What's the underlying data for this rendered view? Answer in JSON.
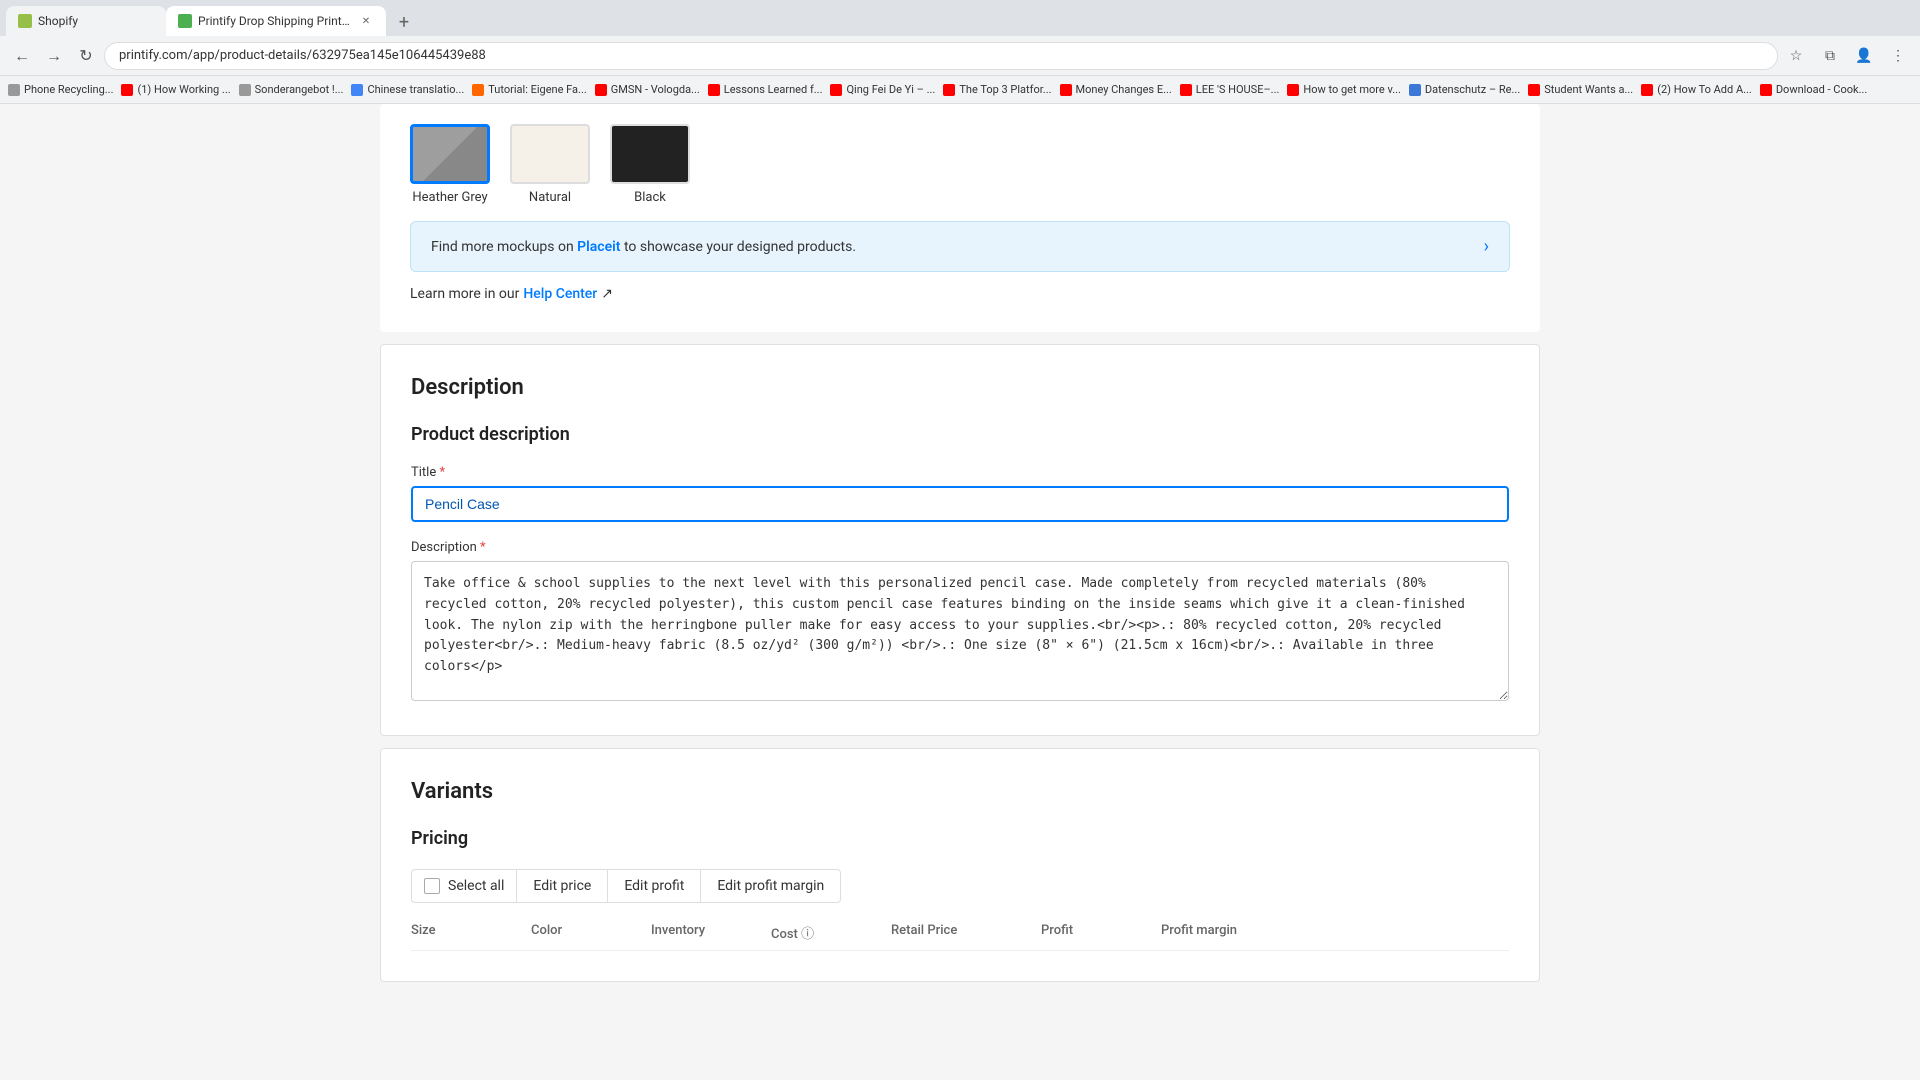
{
  "browser": {
    "tabs": [
      {
        "id": "shopify",
        "label": "Shopify",
        "favicon_color": "#96bf48",
        "active": false
      },
      {
        "id": "printify",
        "label": "Printify Drop Shipping Print o...",
        "favicon_color": "#4CAF50",
        "active": true
      }
    ],
    "new_tab_label": "+",
    "address": "printify.com/app/product-details/632975ea145e106445439e88",
    "bookmarks": [
      "Phone Recycling...",
      "(1) How Working ...",
      "Sonderangebot !...",
      "Chinese translatio...",
      "Tutorial: Eigene Fa...",
      "GMSN - Vologda...",
      "Lessons Learned f...",
      "Qing Fei De Yi – ...",
      "The Top 3 Platfor...",
      "Money Changes E...",
      "LEE 'S HOUSE–...",
      "How to get more v...",
      "Datenschutz – Re...",
      "Student Wants a...",
      "(2) How To Add A...",
      "Download - Cook..."
    ]
  },
  "swatches": {
    "items": [
      {
        "id": "heather-grey",
        "label": "Heather Grey",
        "active": true
      },
      {
        "id": "natural",
        "label": "Natural",
        "active": false
      },
      {
        "id": "black",
        "label": "Black",
        "active": false
      }
    ]
  },
  "placeit_banner": {
    "text_prefix": "Find more mockups on ",
    "link_text": "Placeit",
    "text_suffix": " to showcase your designed products.",
    "arrow": "›"
  },
  "help_center": {
    "prefix": "Learn more in our ",
    "link_text": "Help Center",
    "icon": "↗"
  },
  "description_section": {
    "title": "Description",
    "subsection_title": "Product description",
    "title_field": {
      "label": "Title",
      "required": true,
      "value": "Pencil Case"
    },
    "description_field": {
      "label": "Description",
      "required": true,
      "value": "Take office & school supplies to the next level with this personalized pencil case. Made completely from recycled materials (80% recycled cotton, 20% recycled polyester), this custom pencil case features binding on the inside seams which give it a clean-finished look. The nylon zip with the herringbone puller make for easy access to your supplies.<br/><p>.: 80% recycled cotton, 20% recycled polyester<br/>.: Medium-heavy fabric (8.5 oz/yd² (300 g/m²)) <br/>.: One size (8\" × 6\") (21.5cm x 16cm)<br/>.: Available in three colors</p>"
    }
  },
  "variants_section": {
    "title": "Variants"
  },
  "pricing_section": {
    "title": "Pricing",
    "select_all_label": "Select all",
    "edit_price_label": "Edit price",
    "edit_profit_label": "Edit profit",
    "edit_profit_margin_label": "Edit profit margin",
    "columns": [
      "Size",
      "Color",
      "Inventory",
      "Cost ⓘ",
      "Retail Price",
      "Profit",
      "Profit margin"
    ]
  },
  "colors": {
    "accent_blue": "#007bff",
    "title_input_text": "#0056b3",
    "banner_bg": "#e8f4fd"
  }
}
